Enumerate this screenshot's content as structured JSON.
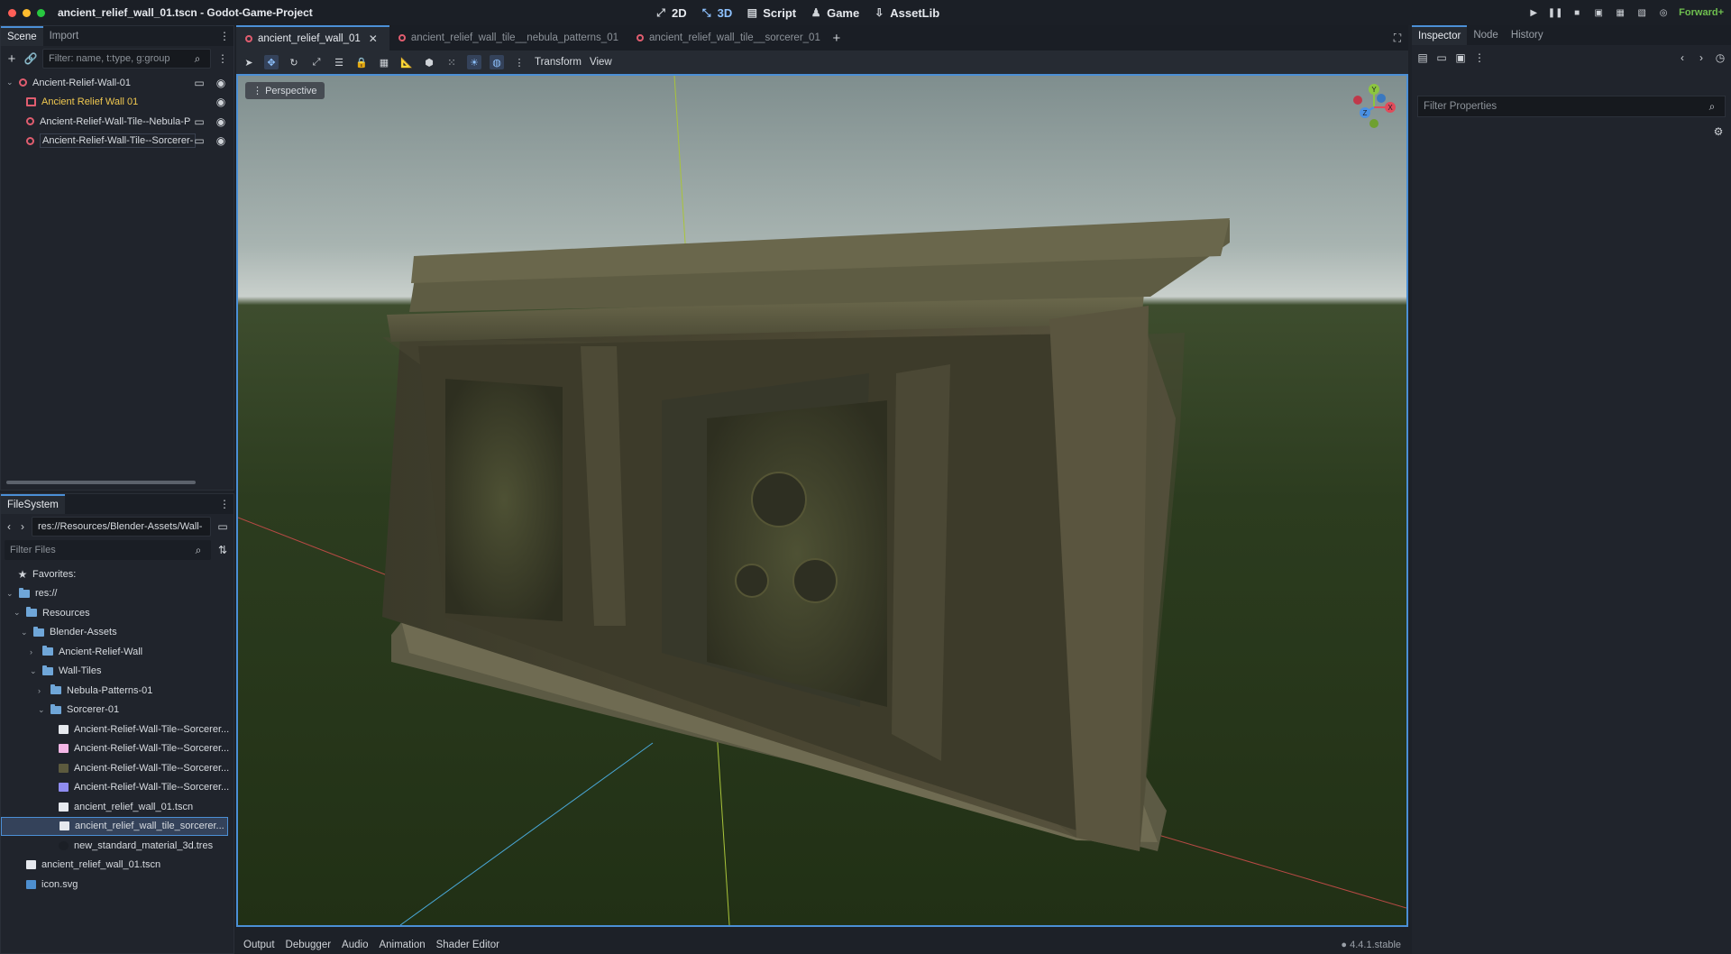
{
  "window": {
    "title": "ancient_relief_wall_01.tscn - Godot-Game-Project",
    "traffic_colors": [
      "#ff5f57",
      "#febc2e",
      "#28c840"
    ]
  },
  "main_nav": [
    {
      "label": "2D",
      "icon": "2d-icon",
      "active": false
    },
    {
      "label": "3D",
      "icon": "3d-icon",
      "active": true
    },
    {
      "label": "Script",
      "icon": "script-icon",
      "active": false
    },
    {
      "label": "Game",
      "icon": "game-icon",
      "active": false
    },
    {
      "label": "AssetLib",
      "icon": "assetlib-icon",
      "active": false
    }
  ],
  "run_controls": {
    "renderer": "Forward+"
  },
  "scene_dock": {
    "tabs": [
      "Scene",
      "Import"
    ],
    "filter_placeholder": "Filter: name, t:type, g:group",
    "nodes": [
      {
        "label": "Ancient-Relief-Wall-01",
        "color": "#d7dbe0"
      },
      {
        "label": "Ancient Relief Wall 01",
        "color": "#f0c850"
      },
      {
        "label": "Ancient-Relief-Wall-Tile--Nebula-P",
        "color": "#d7dbe0"
      },
      {
        "label": "Ancient-Relief-Wall-Tile--Sorcerer-",
        "color": "#d7dbe0"
      }
    ]
  },
  "filesystem": {
    "tab": "FileSystem",
    "path": "res://Resources/Blender-Assets/Wall-",
    "filter_placeholder": "Filter Files",
    "favorites": "Favorites:",
    "items": [
      {
        "label": "res://",
        "type": "folder"
      },
      {
        "label": "Resources",
        "type": "folder"
      },
      {
        "label": "Blender-Assets",
        "type": "folder"
      },
      {
        "label": "Ancient-Relief-Wall",
        "type": "folder"
      },
      {
        "label": "Wall-Tiles",
        "type": "folder"
      },
      {
        "label": "Nebula-Patterns-01",
        "type": "folder"
      },
      {
        "label": "Sorcerer-01",
        "type": "folder"
      },
      {
        "label": "Ancient-Relief-Wall-Tile--Sorcerer...",
        "type": "scene"
      },
      {
        "label": "Ancient-Relief-Wall-Tile--Sorcerer...",
        "type": "texture-pink"
      },
      {
        "label": "Ancient-Relief-Wall-Tile--Sorcerer...",
        "type": "texture-stone"
      },
      {
        "label": "Ancient-Relief-Wall-Tile--Sorcerer...",
        "type": "texture-normal"
      },
      {
        "label": "ancient_relief_wall_01.tscn",
        "type": "scene"
      },
      {
        "label": "ancient_relief_wall_tile_sorcerer...",
        "type": "scene"
      },
      {
        "label": "new_standard_material_3d.tres",
        "type": "material"
      },
      {
        "label": "ancient_relief_wall_01.tscn",
        "type": "scene"
      },
      {
        "label": "icon.svg",
        "type": "svg"
      }
    ]
  },
  "doc_tabs": [
    {
      "label": "ancient_relief_wall_01",
      "active": true
    },
    {
      "label": "ancient_relief_wall_tile__nebula_patterns_01",
      "active": false
    },
    {
      "label": "ancient_relief_wall_tile__sorcerer_01",
      "active": false
    }
  ],
  "viewport_toolbar": {
    "transform": "Transform",
    "view": "View"
  },
  "viewport": {
    "perspective": "Perspective",
    "gizmo": {
      "y": "Y",
      "x": "X",
      "z": "Z"
    }
  },
  "bottom_panel": [
    "Output",
    "Debugger",
    "Audio",
    "Animation",
    "Shader Editor"
  ],
  "version": "4.4.1.stable",
  "inspector": {
    "tabs": [
      "Inspector",
      "Node",
      "History"
    ],
    "filter_placeholder": "Filter Properties"
  }
}
